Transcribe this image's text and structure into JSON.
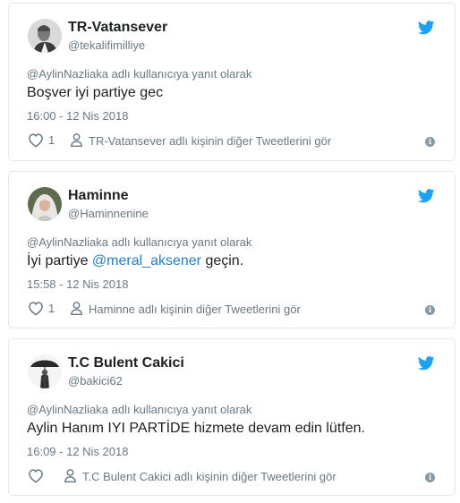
{
  "colors": {
    "twitter_blue": "#1da1f2",
    "link": "#2b7bb9",
    "muted": "#697882",
    "border": "#e1e8ed"
  },
  "tweets": [
    {
      "author_name": "TR-Vatansever",
      "author_handle": "@tekalifimilliye",
      "reply_to": "@AylinNazliaka adlı kullanıcıya yanıt olarak",
      "text_before": "Boşver iyi partiye gec",
      "mention": "",
      "text_after": "",
      "timestamp": "16:00 - 12 Nis 2018",
      "like_count": "1",
      "more_link": "TR-Vatansever adlı kişinin diğer Tweetlerini gör",
      "icons": [
        "heart-icon",
        "person-icon",
        "info-icon",
        "twitter-bird-icon"
      ]
    },
    {
      "author_name": "Haminne",
      "author_handle": "@Haminnenine",
      "reply_to": "@AylinNazliaka adlı kullanıcıya yanıt olarak",
      "text_before": "İyi partiye ",
      "mention": "@meral_aksener",
      "text_after": " geçin.",
      "timestamp": "15:58 - 12 Nis 2018",
      "like_count": "1",
      "more_link": "Haminne adlı kişinin diğer Tweetlerini gör",
      "icons": [
        "heart-icon",
        "person-icon",
        "info-icon",
        "twitter-bird-icon"
      ]
    },
    {
      "author_name": "T.C Bulent Cakici",
      "author_handle": "@bakici62",
      "reply_to": "@AylinNazliaka adlı kullanıcıya yanıt olarak",
      "text_before": "Aylin Hanım IYI PARTİDE hizmete devam edin lütfen.",
      "mention": "",
      "text_after": "",
      "timestamp": "16:09 - 12 Nis 2018",
      "like_count": "",
      "more_link": "T.C Bulent Cakici adlı kişinin diğer Tweetlerini gör",
      "icons": [
        "heart-icon",
        "person-icon",
        "info-icon",
        "twitter-bird-icon"
      ]
    }
  ]
}
